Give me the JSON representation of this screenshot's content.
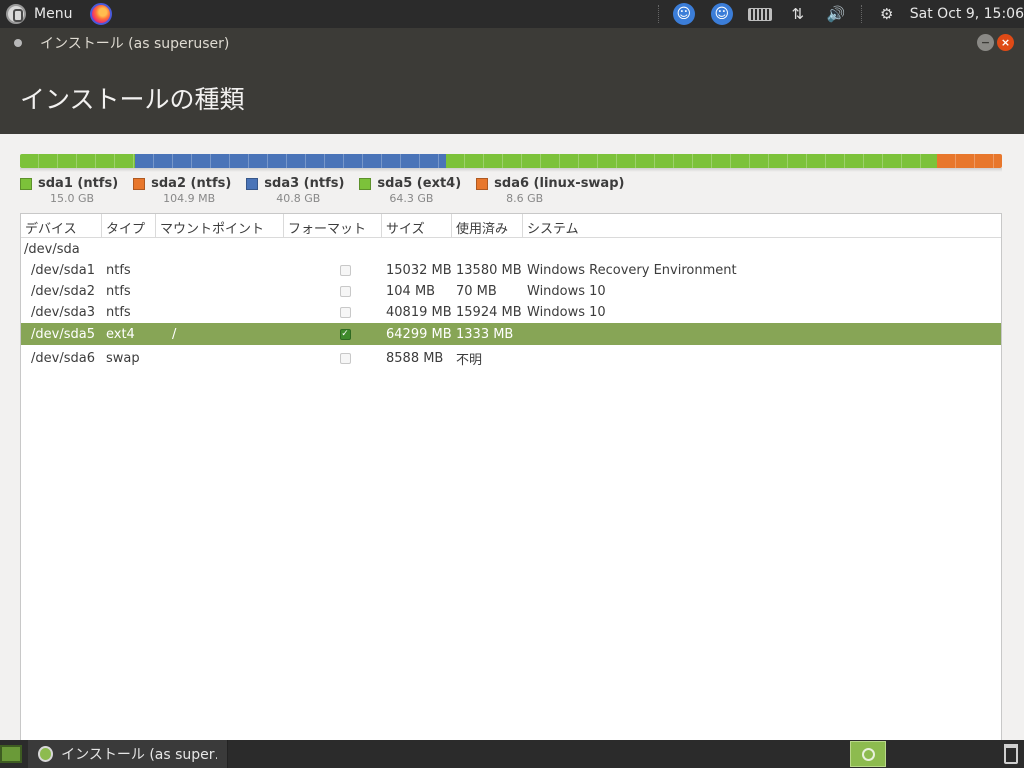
{
  "top_panel": {
    "menu_label": "Menu",
    "clock": "Sat Oct  9, 15:06",
    "icons": [
      "menu-icon",
      "firefox-icon",
      "accessibility-icon",
      "universal-access-icon",
      "keyboard-icon",
      "network-icon",
      "volume-icon",
      "settings-icon"
    ]
  },
  "window": {
    "title": "インストール (as superuser)",
    "minimize_glyph": "−",
    "close_glyph": "×"
  },
  "header": {
    "title": "インストールの種類"
  },
  "partition_bar": {
    "segments": [
      {
        "id": "sda1",
        "width_pct": 11.7,
        "color": "#7cc23a"
      },
      {
        "id": "sda2",
        "width_pct": 0,
        "color": "#e8772c"
      },
      {
        "id": "sda3",
        "width_pct": 31.7,
        "color": "#4a74b8"
      },
      {
        "id": "sda5",
        "width_pct": 50.0,
        "color": "#7cc23a"
      },
      {
        "id": "sda6",
        "width_pct": 6.6,
        "color": "#e8772c"
      }
    ]
  },
  "legend": [
    {
      "label": "sda1 (ntfs)",
      "size": "15.0 GB",
      "color": "#7cc23a"
    },
    {
      "label": "sda2 (ntfs)",
      "size": "104.9 MB",
      "color": "#e8772c"
    },
    {
      "label": "sda3 (ntfs)",
      "size": "40.8 GB",
      "color": "#4a74b8"
    },
    {
      "label": "sda5 (ext4)",
      "size": "64.3 GB",
      "color": "#7cc23a"
    },
    {
      "label": "sda6 (linux-swap)",
      "size": "8.6 GB",
      "color": "#e8772c"
    }
  ],
  "table": {
    "headers": {
      "device": "デバイス",
      "type": "タイプ",
      "mount": "マウントポイント",
      "format": "フォーマット",
      "size": "サイズ",
      "used": "使用済み",
      "system": "システム"
    },
    "disk": "/dev/sda",
    "rows": [
      {
        "device": "/dev/sda1",
        "type": "ntfs",
        "mount": "",
        "format": false,
        "size": "15032 MB",
        "used": "13580 MB",
        "system": "Windows Recovery Environment"
      },
      {
        "device": "/dev/sda2",
        "type": "ntfs",
        "mount": "",
        "format": false,
        "size": "104 MB",
        "used": "70 MB",
        "system": "Windows 10"
      },
      {
        "device": "/dev/sda3",
        "type": "ntfs",
        "mount": "",
        "format": false,
        "size": "40819 MB",
        "used": "15924 MB",
        "system": "Windows 10"
      },
      {
        "device": "/dev/sda5",
        "type": "ext4",
        "mount": "/",
        "format": true,
        "size": "64299 MB",
        "used": "1333 MB",
        "system": "",
        "selected": true
      },
      {
        "device": "/dev/sda6",
        "type": "swap",
        "mount": "",
        "format": false,
        "size": "8588 MB",
        "used": "不明",
        "system": ""
      }
    ]
  },
  "taskbar": {
    "task_label": "インストール (as super…"
  }
}
